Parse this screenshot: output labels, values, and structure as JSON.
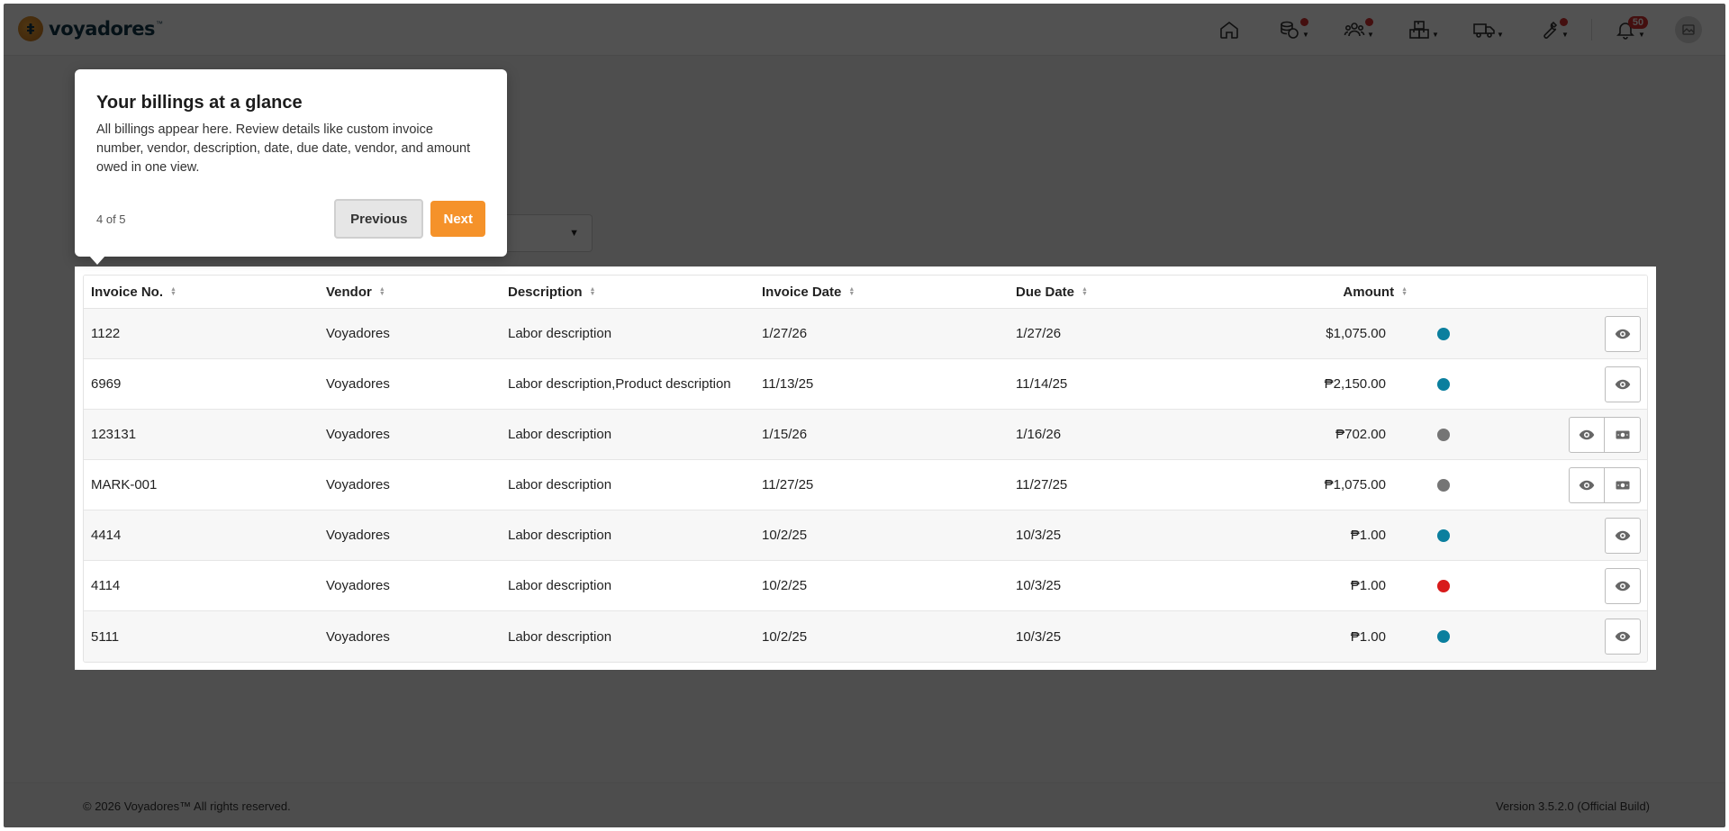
{
  "app": {
    "logo_text": "voyadores",
    "logo_tm": "™"
  },
  "nav": {
    "notification_count": "50",
    "items": [
      {
        "icon": "home-icon",
        "dot": false,
        "caret": false
      },
      {
        "icon": "coins-icon",
        "dot": true,
        "caret": true
      },
      {
        "icon": "users-icon",
        "dot": true,
        "caret": true
      },
      {
        "icon": "boxes-icon",
        "dot": false,
        "caret": true
      },
      {
        "icon": "truck-icon",
        "dot": false,
        "caret": true
      },
      {
        "icon": "wrench-icon",
        "dot": true,
        "caret": true
      }
    ]
  },
  "tour": {
    "title": "Your billings at a glance",
    "body": "All billings appear here. Review details like custom invoice number, vendor, description, date, due date, vendor, and amount owed in one view.",
    "step": "4 of 5",
    "prev_label": "Previous",
    "next_label": "Next"
  },
  "table": {
    "headers": {
      "invoice_no": "Invoice No.",
      "vendor": "Vendor",
      "description": "Description",
      "invoice_date": "Invoice Date",
      "due_date": "Due Date",
      "amount": "Amount"
    },
    "rows": [
      {
        "invoice_no": "1122",
        "vendor": "Voyadores",
        "description": "Labor description",
        "invoice_date": "1/27/26",
        "due_date": "1/27/26",
        "amount": "$1,075.00",
        "status_color": "#0b7f9e",
        "actions": [
          "view"
        ]
      },
      {
        "invoice_no": "6969",
        "vendor": "Voyadores",
        "description": "Labor description,Product description",
        "invoice_date": "11/13/25",
        "due_date": "11/14/25",
        "amount": "₱2,150.00",
        "status_color": "#0b7f9e",
        "actions": [
          "view"
        ]
      },
      {
        "invoice_no": "123131",
        "vendor": "Voyadores",
        "description": "Labor description",
        "invoice_date": "1/15/26",
        "due_date": "1/16/26",
        "amount": "₱702.00",
        "status_color": "#757575",
        "actions": [
          "view",
          "pay"
        ]
      },
      {
        "invoice_no": "MARK-001",
        "vendor": "Voyadores",
        "description": "Labor description",
        "invoice_date": "11/27/25",
        "due_date": "11/27/25",
        "amount": "₱1,075.00",
        "status_color": "#757575",
        "actions": [
          "view",
          "pay"
        ]
      },
      {
        "invoice_no": "4414",
        "vendor": "Voyadores",
        "description": "Labor description",
        "invoice_date": "10/2/25",
        "due_date": "10/3/25",
        "amount": "₱1.00",
        "status_color": "#0b7f9e",
        "actions": [
          "view"
        ]
      },
      {
        "invoice_no": "4114",
        "vendor": "Voyadores",
        "description": "Labor description",
        "invoice_date": "10/2/25",
        "due_date": "10/3/25",
        "amount": "₱1.00",
        "status_color": "#d81b1b",
        "actions": [
          "view"
        ]
      },
      {
        "invoice_no": "5111",
        "vendor": "Voyadores",
        "description": "Labor description",
        "invoice_date": "10/2/25",
        "due_date": "10/3/25",
        "amount": "₱1.00",
        "status_color": "#0b7f9e",
        "actions": [
          "view"
        ]
      }
    ]
  },
  "footer": {
    "copyright": "© 2026 Voyadores™ All rights reserved.",
    "version": "Version 3.5.2.0 (Official Build)"
  },
  "colors": {
    "accent": "#f5922a",
    "brand": "#10364a",
    "overlay": "rgba(0,0,0,0.68)"
  }
}
